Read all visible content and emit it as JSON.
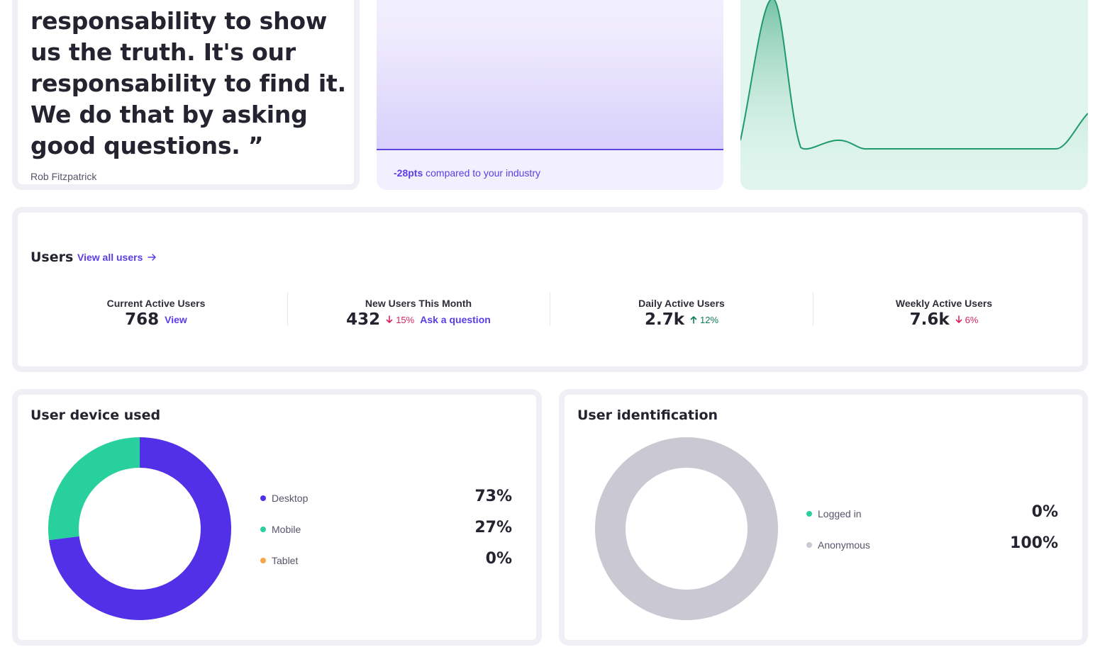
{
  "quote": {
    "text": "responsability to show us the truth. It's our responsability to find it. We do that by asking good questions. ”",
    "author": "Rob Fitzpatrick"
  },
  "industry": {
    "delta": "-28pts",
    "note": "compared to your industry"
  },
  "users": {
    "title": "Users",
    "view_all": "View all users",
    "stats": [
      {
        "label": "Current Active Users",
        "value": "768",
        "link": "View"
      },
      {
        "label": "New Users This Month",
        "value": "432",
        "trend": "15%",
        "trend_dir": "down",
        "link": "Ask a question"
      },
      {
        "label": "Daily Active Users",
        "value": "2.7k",
        "trend": "12%",
        "trend_dir": "up"
      },
      {
        "label": "Weekly Active Users",
        "value": "7.6k",
        "trend": "6%",
        "trend_dir": "down"
      }
    ]
  },
  "device": {
    "title": "User device used",
    "items": [
      {
        "label": "Desktop",
        "value": "73%",
        "share": 73,
        "color": "#5230e8"
      },
      {
        "label": "Mobile",
        "value": "27%",
        "share": 27,
        "color": "#27d09c"
      },
      {
        "label": "Tablet",
        "value": "0%",
        "share": 0,
        "color": "#f7a646"
      }
    ]
  },
  "identification": {
    "title": "User identification",
    "items": [
      {
        "label": "Logged in",
        "value": "0%",
        "share": 0,
        "color": "#27d09c"
      },
      {
        "label": "Anonymous",
        "value": "100%",
        "share": 100,
        "color": "#c9c8d3"
      }
    ]
  },
  "colors": {
    "accent": "#5b3ce8",
    "green_line": "#1f9a6b",
    "down": "#d6245d",
    "up": "#0d7d55"
  }
}
